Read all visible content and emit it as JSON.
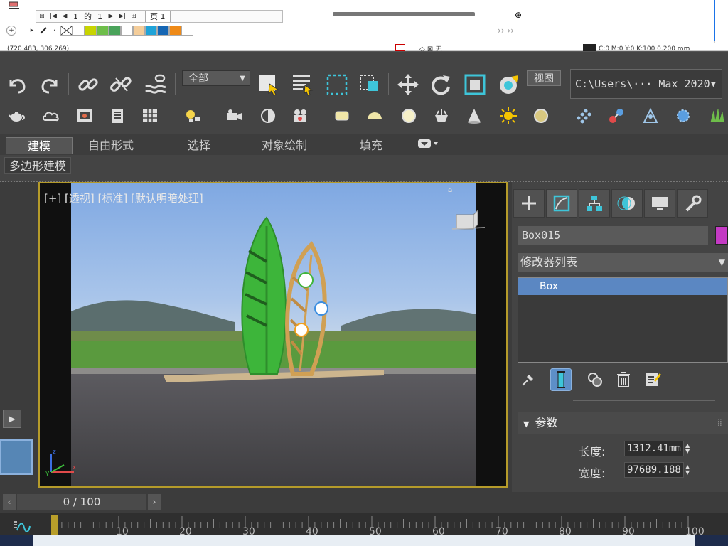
{
  "top_app": {
    "page_current": "1",
    "page_of": "的",
    "page_total": "1",
    "page_tab": "页 1",
    "coords_left": "(720.483, 306.269)",
    "coords_right": "C:0 M:0 Y:0 K:100  0.200 mm",
    "mid_label": "无",
    "nav_more": "›› ››",
    "swatches": [
      "#ffffff",
      "#c8d400",
      "#6ebe4a",
      "#4aa35a",
      "#ffffff",
      "#f4cd9a",
      "#1fa3d8",
      "#1566b4",
      "#ef8a17",
      "#ffffff"
    ]
  },
  "toolbar": {
    "selection_filter": "全部",
    "view_label": "视图",
    "path": "C:\\Users\\··· Max 2020"
  },
  "ribbon": {
    "tabs": [
      "建模",
      "自由形式",
      "选择",
      "对象绘制",
      "填充"
    ],
    "sub_label": "多边形建模"
  },
  "viewport": {
    "label": "[+] [透视] [标准] [默认明暗处理]"
  },
  "command_panel": {
    "object_name": "Box015",
    "object_color": "#c43ac4",
    "modifier_list": "修改器列表",
    "stack_items": [
      "Box"
    ],
    "params_title": "参数",
    "length_label": "长度:",
    "length_value": "1312.41mm",
    "width_label": "宽度:",
    "width_value": "97689.188"
  },
  "time_slider": {
    "frame_display": "0 / 100"
  },
  "track_bar": {
    "ticks": [
      "0",
      "10",
      "20",
      "30",
      "40",
      "50",
      "60",
      "70",
      "80",
      "90",
      "100"
    ]
  }
}
